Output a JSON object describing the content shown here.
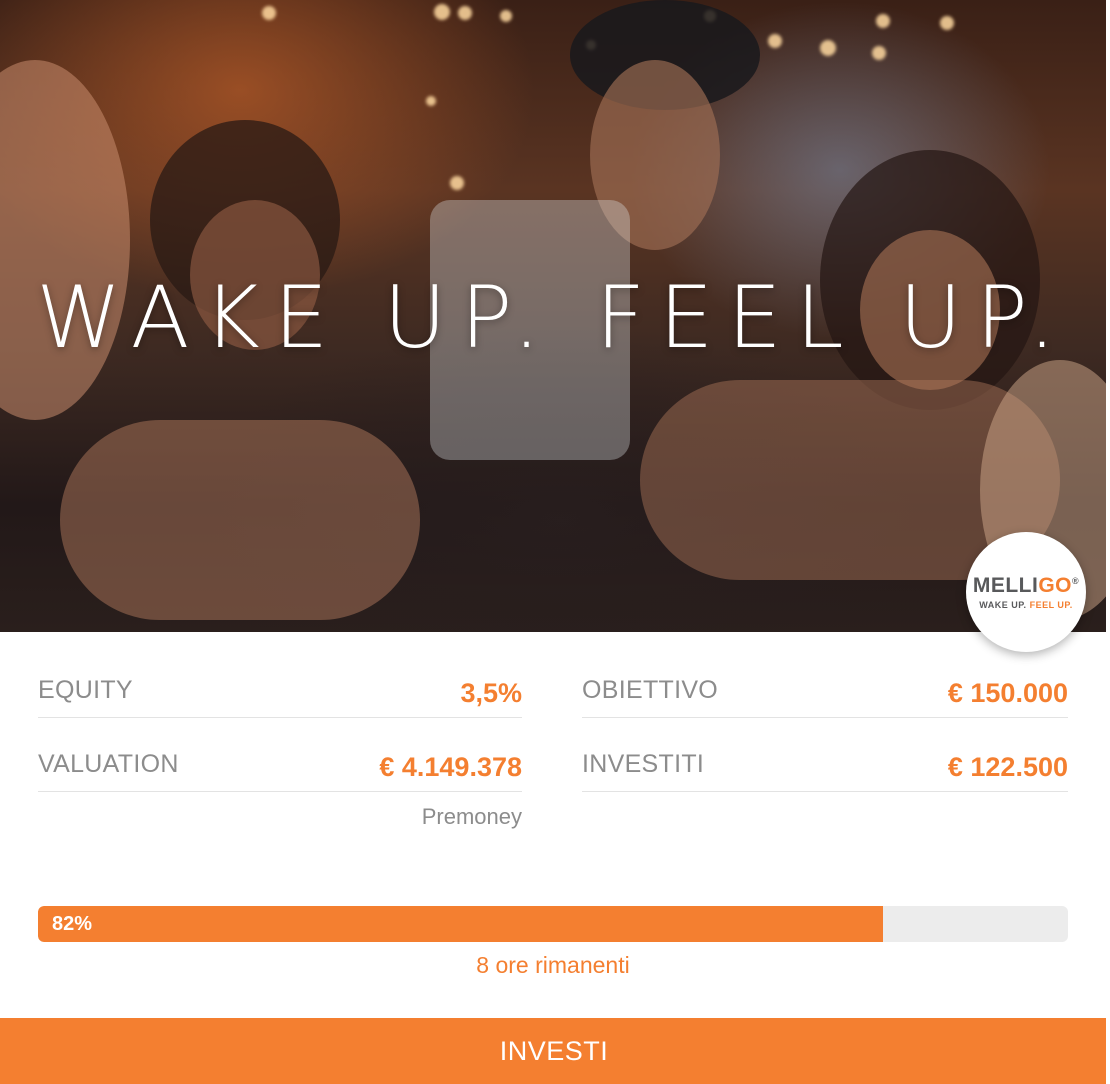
{
  "hero": {
    "headline": "WAKE UP. FEEL UP.",
    "logo": {
      "name_main": "MELLI",
      "name_accent": "GO",
      "registered": "®",
      "tagline_main": "WAKE UP.",
      "tagline_accent": "FEEL UP."
    }
  },
  "stats": {
    "equity": {
      "label": "EQUITY",
      "value": "3,5%"
    },
    "objective": {
      "label": "OBIETTIVO",
      "value": "€ 150.000"
    },
    "valuation": {
      "label": "VALUATION",
      "value": "€ 4.149.378",
      "note": "Premoney"
    },
    "invested": {
      "label": "INVESTITI",
      "value": "€ 122.500"
    }
  },
  "progress": {
    "percent": 82,
    "label": "82%",
    "time_left": "8 ore rimanenti"
  },
  "actions": {
    "invest_label": "INVESTI"
  },
  "colors": {
    "accent": "#f47f30",
    "label_gray": "#8c8c8c",
    "track_gray": "#ececec"
  }
}
